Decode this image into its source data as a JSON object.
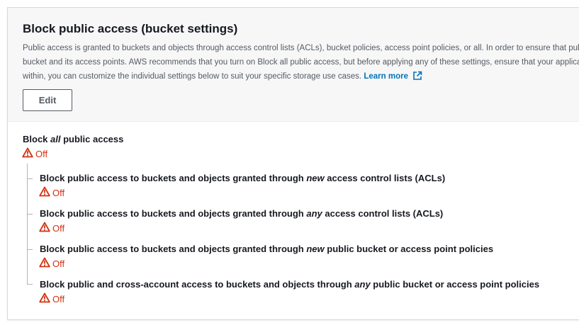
{
  "section": {
    "title": "Block public access (bucket settings)",
    "description_lines": [
      "Public access is granted to buckets and objects through access control lists (ACLs), bucket policies, access point policies, or all. In order to ensure that public access to this",
      "bucket and its access points. AWS recommends that you turn on Block all public access, but before applying any of these settings, ensure that your applications will work correctly",
      "within, you can customize the individual settings below to suit your specific storage use cases."
    ],
    "learn_more": "Learn more",
    "edit_label": "Edit"
  },
  "block_all": {
    "label_pre": "Block ",
    "label_em": "all",
    "label_post": " public access",
    "status": "Off"
  },
  "sub_settings": [
    {
      "label_pre": "Block public access to buckets and objects granted through ",
      "label_em": "new",
      "label_post": " access control lists (ACLs)",
      "status": "Off"
    },
    {
      "label_pre": "Block public access to buckets and objects granted through ",
      "label_em": "any",
      "label_post": " access control lists (ACLs)",
      "status": "Off"
    },
    {
      "label_pre": "Block public access to buckets and objects granted through ",
      "label_em": "new",
      "label_post": " public bucket or access point policies",
      "status": "Off"
    },
    {
      "label_pre": "Block public and cross-account access to buckets and objects through ",
      "label_em": "any",
      "label_post": " public bucket or access point policies",
      "status": "Off"
    }
  ],
  "colors": {
    "status_off": "#d13212",
    "link": "#0073bb",
    "header_bg": "#f7f7f7"
  },
  "icons": {
    "status": "warning-triangle-icon",
    "external_link": "external-link-icon"
  }
}
